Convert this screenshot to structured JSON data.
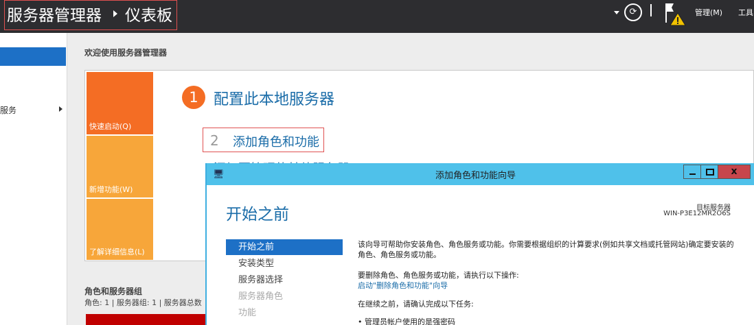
{
  "header": {
    "app_title": "服务器管理器",
    "breadcrumb": "仪表板",
    "menu_manage": "管理(M)",
    "menu_tools": "工具"
  },
  "sidebar": {
    "items": [
      {
        "label": ""
      },
      {
        "label": "服务"
      }
    ]
  },
  "dashboard": {
    "welcome": "欢迎使用服务器管理器",
    "tiles": [
      "快速启动(Q)",
      "新增功能(W)",
      "了解详细信息(L)"
    ],
    "step1_num": "1",
    "step1_label": "配置此本地服务器",
    "step2_num": "2",
    "step2_label": "添加角色和功能",
    "step3_label": "添加要管理的其他服务器",
    "roles_title": "角色和服务器组",
    "roles_sub": "角色: 1 | 服务器组: 1 | 服务器总数"
  },
  "wizard": {
    "icon": "🖥",
    "title": "添加角色和功能向导",
    "heading": "开始之前",
    "target_label": "目标服务器",
    "target_value": "WIN-P3E12MR2O6S",
    "close_label": "x",
    "nav": [
      "开始之前",
      "安装类型",
      "服务器选择",
      "服务器角色",
      "功能"
    ],
    "text1": "该向导可帮助你安装角色、角色服务或功能。你需要根据组织的计算要求(例如共享文档或托管网站)确定要安装的角色、角色服务或功能。",
    "text2": "要删除角色、角色服务或功能，请执行以下操作:",
    "link": "启动\"删除角色和功能\"向导",
    "text3": "在继续之前，请确认完成以下任务:",
    "text4": "• 管理员帐户使用的是强密码"
  },
  "colors": {
    "topbar": "#2d2d30",
    "accent": "#1d70c6",
    "quick_tile": "#f46d24",
    "tile": "#f7a63a",
    "wizard_bar": "#4fc1ea"
  }
}
